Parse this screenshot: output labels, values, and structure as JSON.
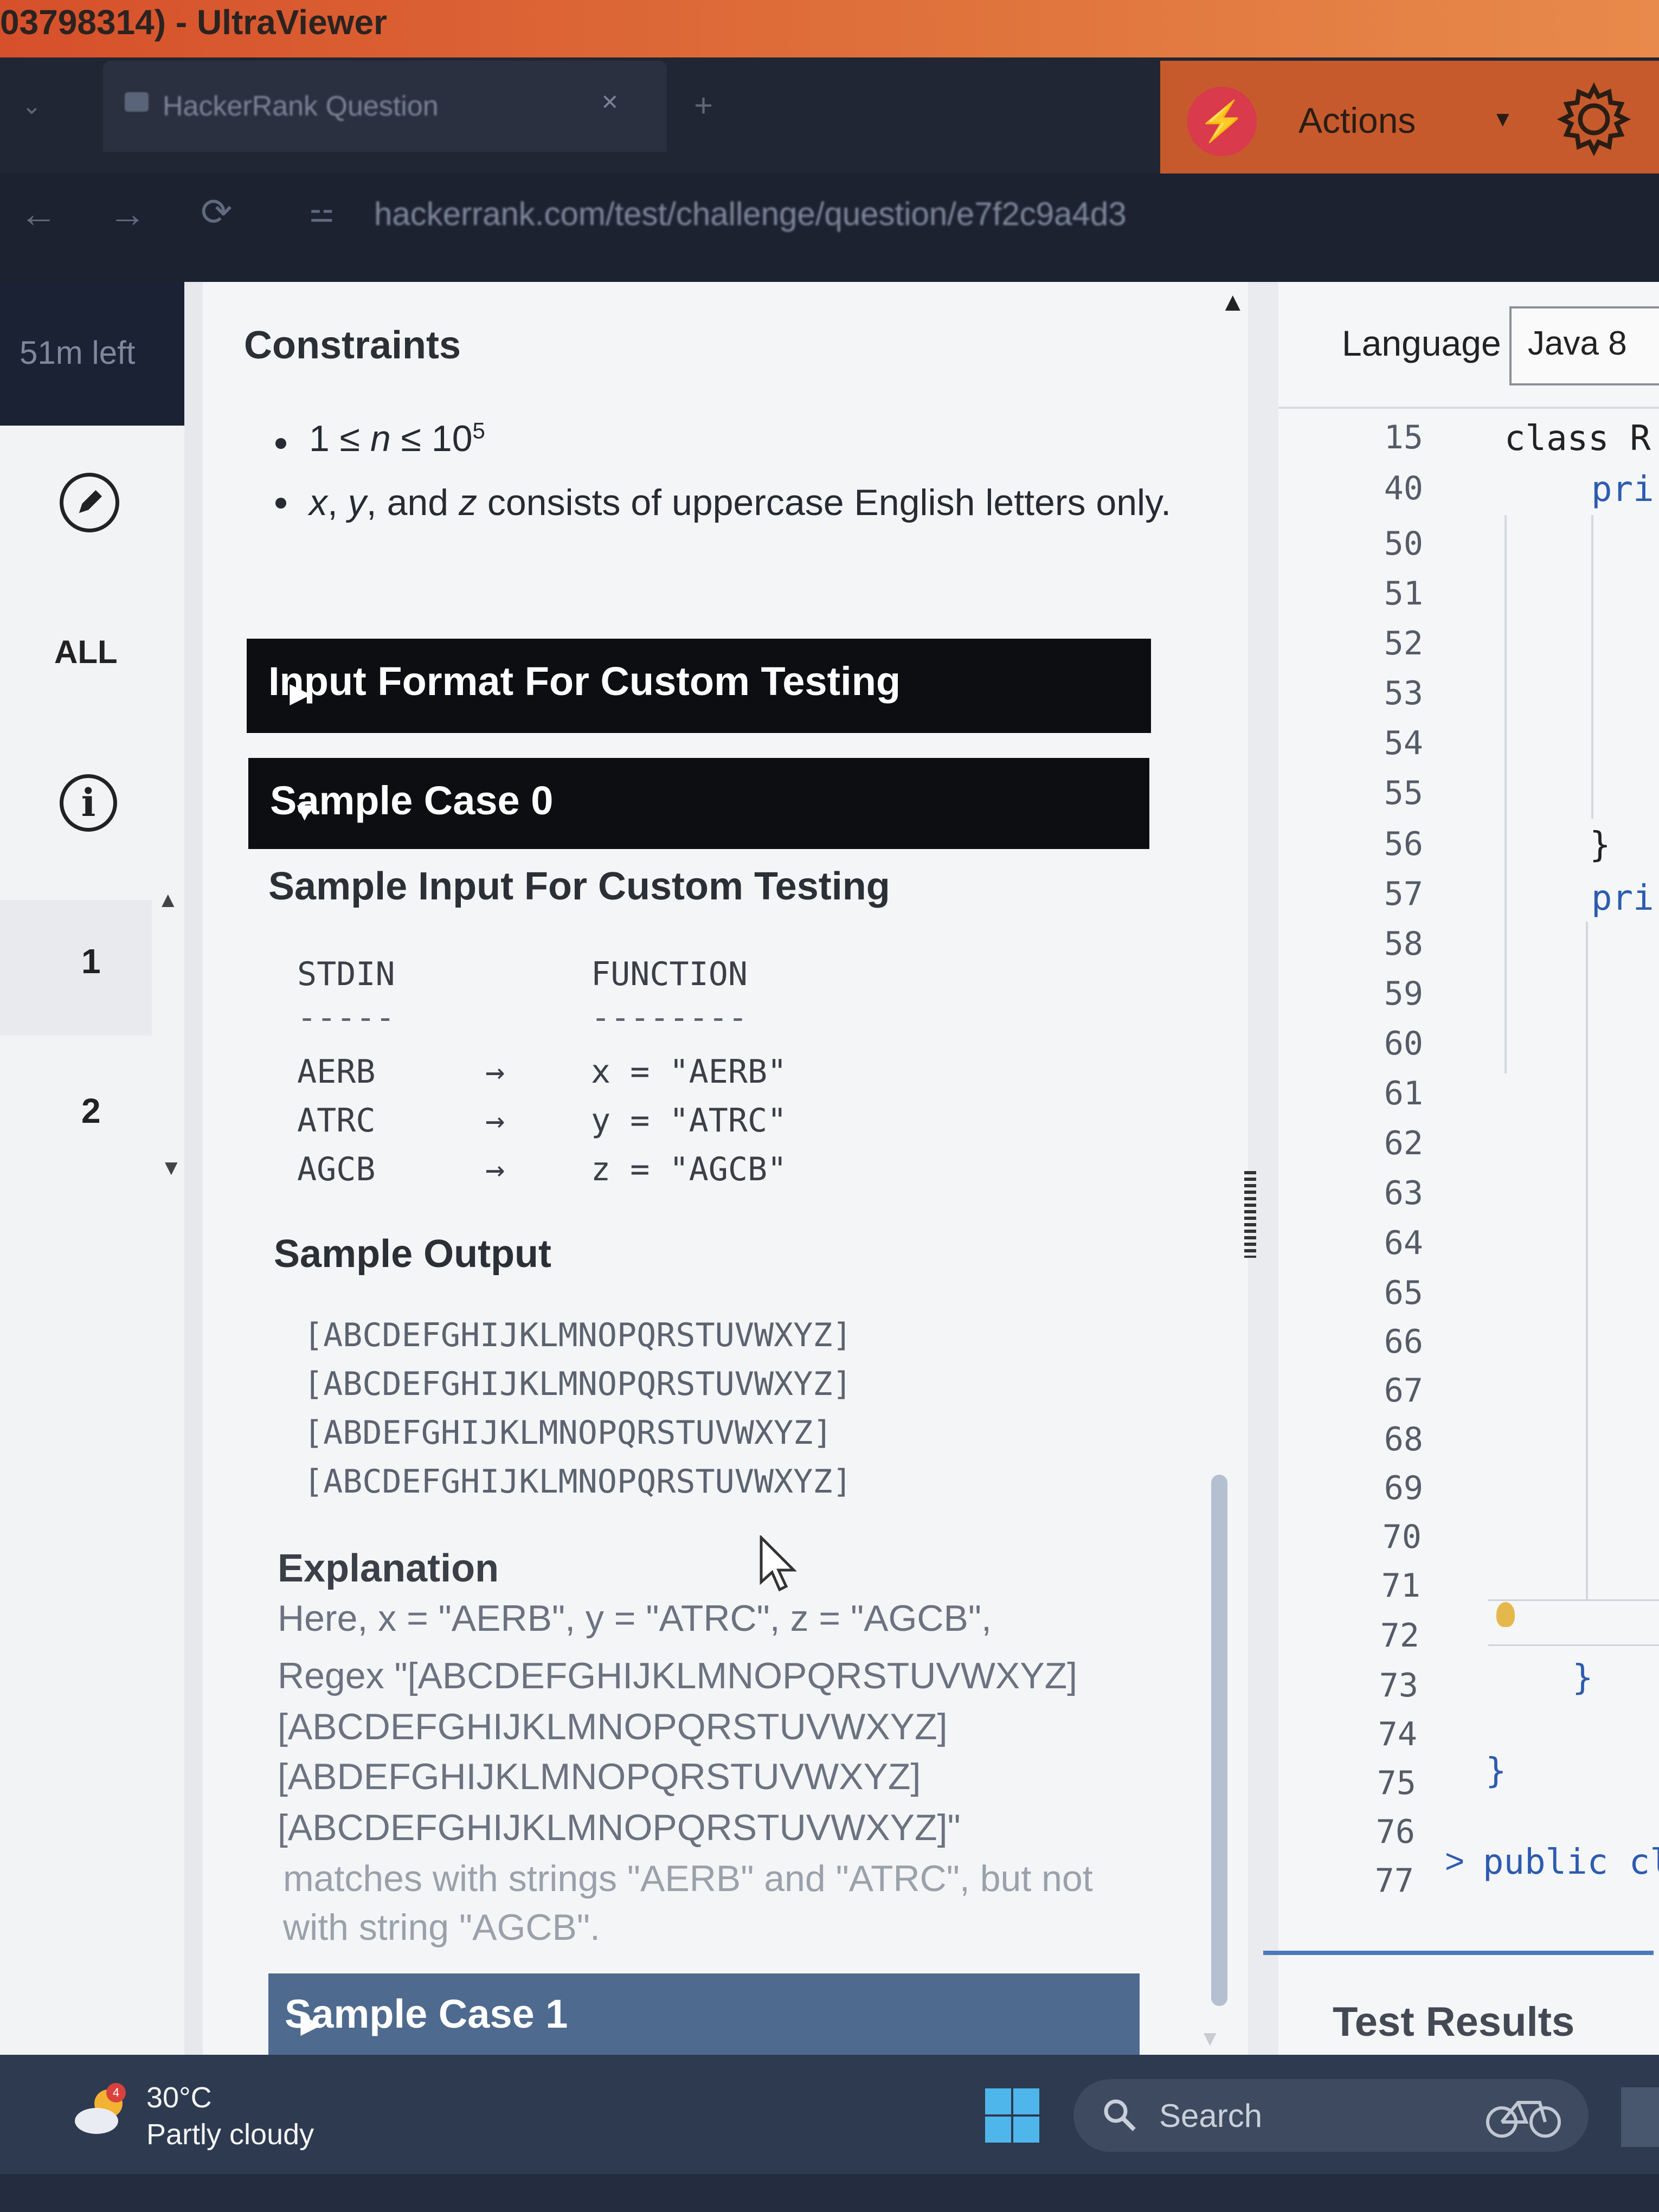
{
  "window": {
    "title": "03798314) - UltraViewer"
  },
  "browser": {
    "tab_title": "HackerRank Question",
    "tab_close": "×",
    "new_tab": "+",
    "tab_menu": "⌄",
    "actions_label": "Actions",
    "url": "hackerrank.com/test/challenge/question/e7f2c9a4d3",
    "nav": {
      "back": "←",
      "forward": "→",
      "reload": "⟳",
      "info": "⚍"
    }
  },
  "sidebar": {
    "time_left": "51m left",
    "all_label": "ALL",
    "questions": [
      "1",
      "2"
    ]
  },
  "problem": {
    "constraints_title": "Constraints",
    "constraints": {
      "c1": {
        "lead": "1 ≤ ",
        "var": "n",
        "mid": " ≤ 10",
        "sup": "5"
      },
      "c2": {
        "x": "x",
        "sep1": ", ",
        "y": "y",
        "sep2": ", and ",
        "z": "z",
        "rest": " consists of uppercase English letters only."
      }
    },
    "accordion_input": "Input Format For Custom Testing",
    "accordion_case0": "Sample Case 0",
    "sample_input_title": "Sample Input For Custom Testing",
    "stdin_header": "STDIN",
    "function_header": "FUNCTION",
    "stdin_rule": "-----",
    "function_rule": "--------",
    "sample_rows": [
      {
        "stdin": "AERB",
        "arrow": "→",
        "func": "x = \"AERB\""
      },
      {
        "stdin": "ATRC",
        "arrow": "→",
        "func": "y = \"ATRC\""
      },
      {
        "stdin": "AGCB",
        "arrow": "→",
        "func": "z = \"AGCB\""
      }
    ],
    "sample_output_title": "Sample Output",
    "sample_output": [
      "[ABCDEFGHIJKLMNOPQRSTUVWXYZ]",
      "[ABCDEFGHIJKLMNOPQRSTUVWXYZ]",
      "[ABDEFGHIJKLMNOPQRSTUVWXYZ]",
      "[ABCDEFGHIJKLMNOPQRSTUVWXYZ]"
    ],
    "explanation_title": "Explanation",
    "explanation_lines": [
      "Here, x = \"AERB\", y = \"ATRC\", z = \"AGCB\",",
      "Regex \"[ABCDEFGHIJKLMNOPQRSTUVWXYZ]",
      "[ABCDEFGHIJKLMNOPQRSTUVWXYZ]",
      "[ABDEFGHIJKLMNOPQRSTUVWXYZ]",
      "[ABCDEFGHIJKLMNOPQRSTUVWXYZ]\"",
      "matches with strings \"AERB\" and \"ATRC\", but not",
      "with string \"AGCB\"."
    ],
    "accordion_case1": "Sample Case 1"
  },
  "editor": {
    "language_label": "Language",
    "language_value": "Java 8",
    "line_numbers": [
      "15",
      "40",
      "50",
      "51",
      "52",
      "53",
      "54",
      "55",
      "56",
      "57",
      "58",
      "59",
      "60",
      "61",
      "62",
      "63",
      "64",
      "65",
      "66",
      "67",
      "68",
      "69",
      "70",
      "71",
      "72",
      "73",
      "74",
      "75",
      "76",
      "77"
    ],
    "code": {
      "l15": "class R",
      "l40": "pri",
      "l56": "}",
      "l57": "pri",
      "l73": "}",
      "l75": "}",
      "l77": "public cl",
      "fold": ">"
    },
    "test_results": "Test Results"
  },
  "taskbar": {
    "weather_badge": "4",
    "temperature": "30°C",
    "condition": "Partly cloudy",
    "search_label": "Search"
  },
  "colors": {
    "titlebar": "#d6502b",
    "accordion_dark": "#0c0e11",
    "accordion_collapsed": "#4f6a8f",
    "code_blue": "#2d5cae",
    "taskbar": "#2d3a4f"
  }
}
